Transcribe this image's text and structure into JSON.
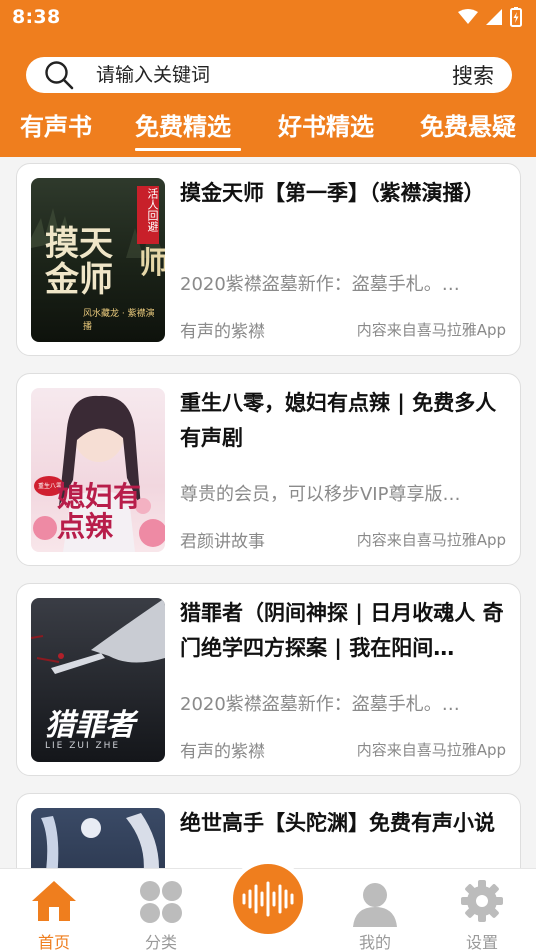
{
  "status_bar": {
    "time": "8:38"
  },
  "search": {
    "placeholder": "请输入关键词",
    "button_label": "搜索"
  },
  "tabs": [
    {
      "label": "有声书",
      "active": false
    },
    {
      "label": "免费精选",
      "active": true
    },
    {
      "label": "好书精选",
      "active": false
    },
    {
      "label": "免费悬疑",
      "active": false
    }
  ],
  "books": [
    {
      "title": "摸金天师【第一季】（紫襟演播）",
      "description": "2020紫襟盗墓新作：盗墓手札。…",
      "author": "有声的紫襟",
      "source": "内容来自喜马拉雅App",
      "cover_text": "摸天金师",
      "cover_badge": "活人回避",
      "cover_sub": "风水藏龙 · 紫襟演播"
    },
    {
      "title": "重生八零，媳妇有点辣 | 免费多人有声剧",
      "description": "尊贵的会员，可以移步VIP尊享版…",
      "author": "君颜讲故事",
      "source": "内容来自喜马拉雅App",
      "cover_text": "媳妇有点辣",
      "cover_badge": "重生八零"
    },
    {
      "title": "猎罪者（阴间神探 | 日月收魂人 奇门绝学四方探案 | 我在阳间…",
      "description": "2020紫襟盗墓新作：盗墓手札。…",
      "author": "有声的紫襟",
      "source": "内容来自喜马拉雅App",
      "cover_text": "猎罪者",
      "cover_sub": "LIE ZUI ZHE"
    },
    {
      "title": "绝世高手【头陀渊】免费有声小说",
      "description": "",
      "author": "",
      "source": "",
      "cover_text": ""
    }
  ],
  "bottom_nav": [
    {
      "label": "首页",
      "icon": "home-icon",
      "active": true
    },
    {
      "label": "分类",
      "icon": "grid-icon",
      "active": false
    },
    {
      "label": "",
      "icon": "audio-wave-icon",
      "active": false
    },
    {
      "label": "我的",
      "icon": "user-icon",
      "active": false
    },
    {
      "label": "设置",
      "icon": "gear-icon",
      "active": false
    }
  ],
  "colors": {
    "accent": "#ef7e1e",
    "text": "#111111",
    "muted": "#8a8a8a"
  }
}
